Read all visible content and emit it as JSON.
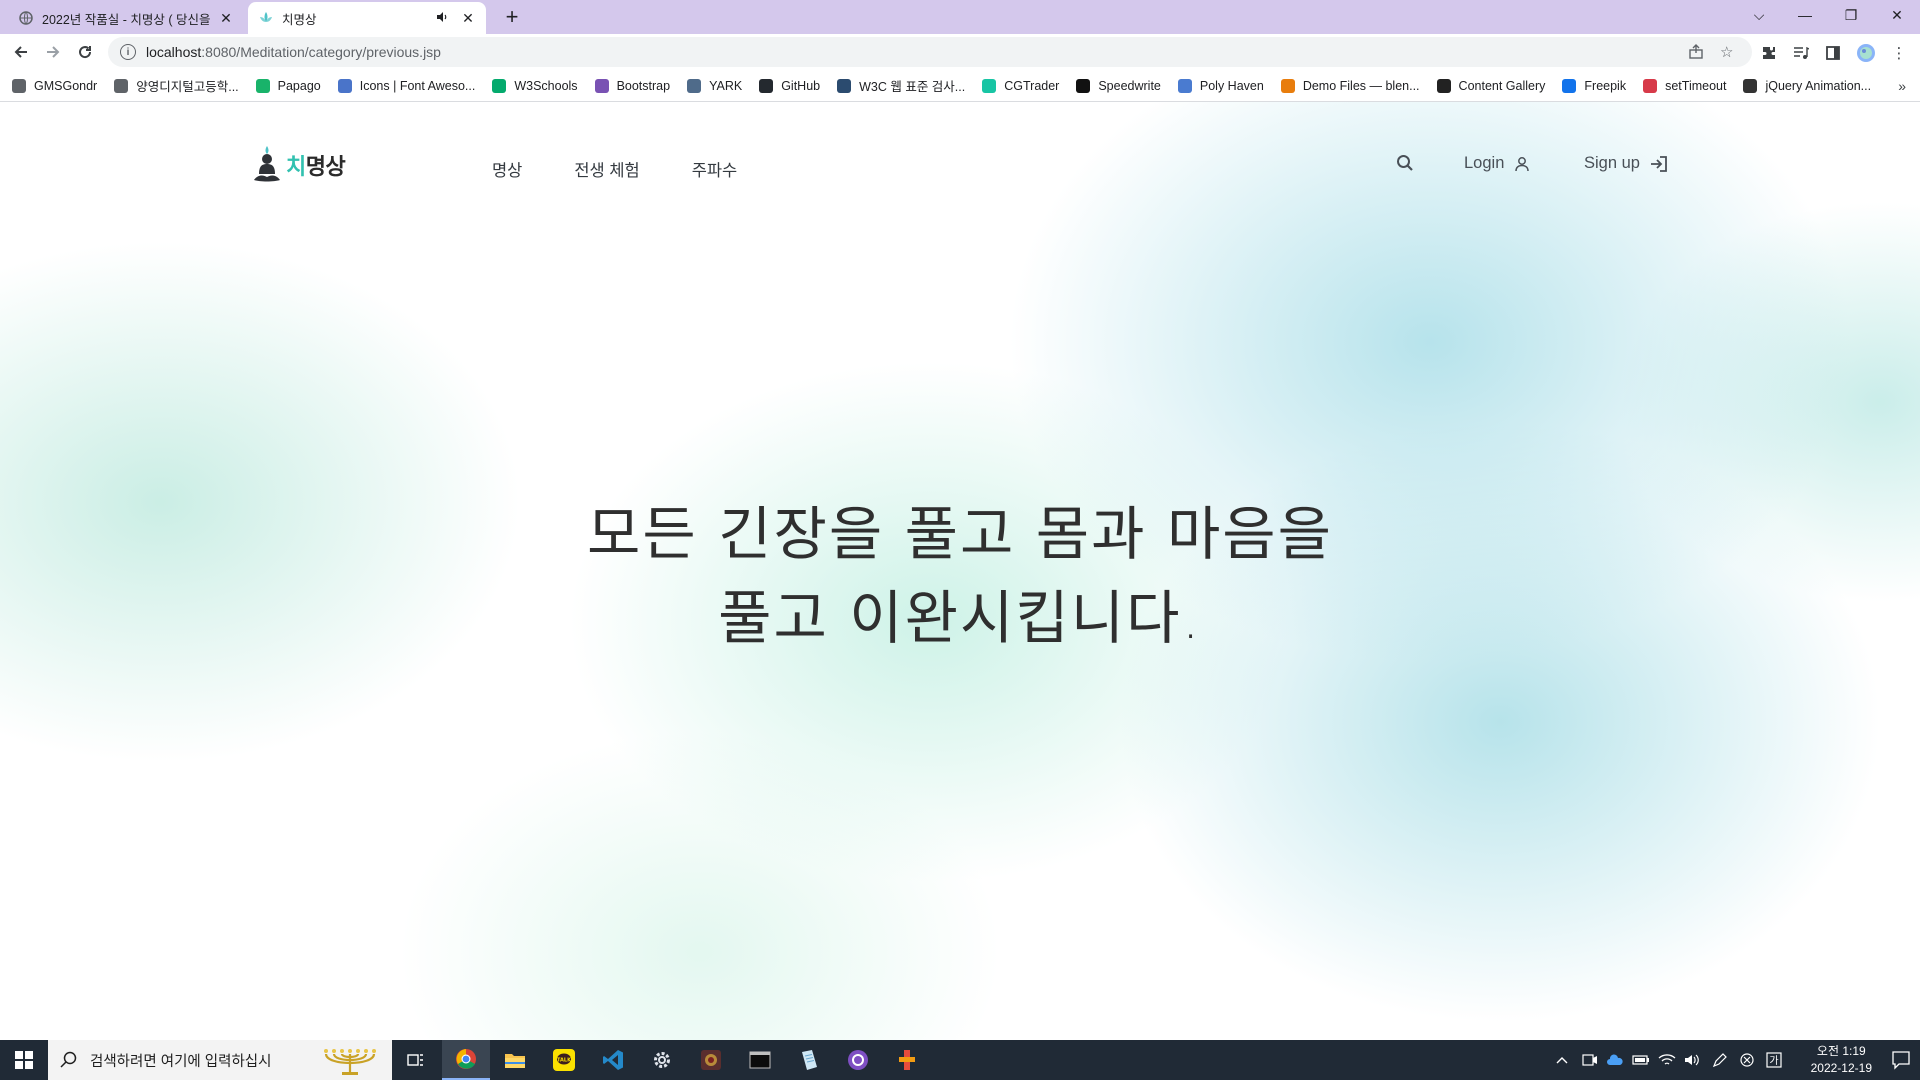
{
  "browser": {
    "tabs": [
      {
        "title": "2022년 작품실 - 치명상 ( 당신을",
        "favicon": "globe-icon",
        "active": false
      },
      {
        "title": "치명상",
        "favicon": "lotus-icon",
        "active": true
      }
    ],
    "window_controls": {
      "dropdown": "⌵",
      "minimize": "—",
      "restore": "❐",
      "close": "✕"
    },
    "address": {
      "host": "localhost",
      "path": ":8080/Meditation/category/previous.jsp"
    },
    "bookmarks": [
      {
        "label": "GMSGondr",
        "icon": "globe-icon",
        "color": "#5f6368"
      },
      {
        "label": "양영디지털고등학...",
        "icon": "globe-icon",
        "color": "#5f6368"
      },
      {
        "label": "Papago",
        "icon": "papago-icon",
        "color": "#19b36a"
      },
      {
        "label": "Icons | Font Aweso...",
        "icon": "flag-icon",
        "color": "#4a74c9"
      },
      {
        "label": "W3Schools",
        "icon": "w3schools-icon",
        "color": "#04aa6d"
      },
      {
        "label": "Bootstrap",
        "icon": "bootstrap-icon",
        "color": "#7952b3"
      },
      {
        "label": "YARK",
        "icon": "yark-icon",
        "color": "#4f6b8a"
      },
      {
        "label": "GitHub",
        "icon": "github-icon",
        "color": "#24292f"
      },
      {
        "label": "W3C 웹 표준 검사...",
        "icon": "w3c-icon",
        "color": "#2b4b6f"
      },
      {
        "label": "CGTrader",
        "icon": "cgtrader-icon",
        "color": "#18c5a4"
      },
      {
        "label": "Speedwrite",
        "icon": "speedwrite-icon",
        "color": "#111111"
      },
      {
        "label": "Poly Haven",
        "icon": "polyhaven-icon",
        "color": "#4a7bd0"
      },
      {
        "label": "Demo Files — blen...",
        "icon": "blender-icon",
        "color": "#e87d0d"
      },
      {
        "label": "Content Gallery",
        "icon": "content-gallery-icon",
        "color": "#222222"
      },
      {
        "label": "Freepik",
        "icon": "freepik-icon",
        "color": "#1273eb"
      },
      {
        "label": "setTimeout",
        "icon": "settimeout-icon",
        "color": "#d73a49"
      },
      {
        "label": "jQuery Animation...",
        "icon": "jquery-icon",
        "color": "#333333"
      }
    ]
  },
  "site": {
    "logo": {
      "accent": "치",
      "rest": "명상"
    },
    "nav": [
      "명상",
      "전생 체험",
      "주파수"
    ],
    "login_label": "Login",
    "signup_label": "Sign up",
    "hero_lines": [
      "모든 긴장을 풀고 몸과 마음을",
      "풀고 이완시킵니다."
    ]
  },
  "taskbar": {
    "search_placeholder": "검색하려면 여기에 입력하십시",
    "apps": [
      "task-view-icon",
      "chrome-icon",
      "file-explorer-icon",
      "kakaotalk-icon",
      "vscode-icon",
      "settings-icon",
      "game-icon",
      "terminal-icon",
      "notepad-icon",
      "github-desktop-icon",
      "app-icon"
    ],
    "clock": {
      "time": "오전 1:19",
      "date": "2022-12-19"
    }
  }
}
